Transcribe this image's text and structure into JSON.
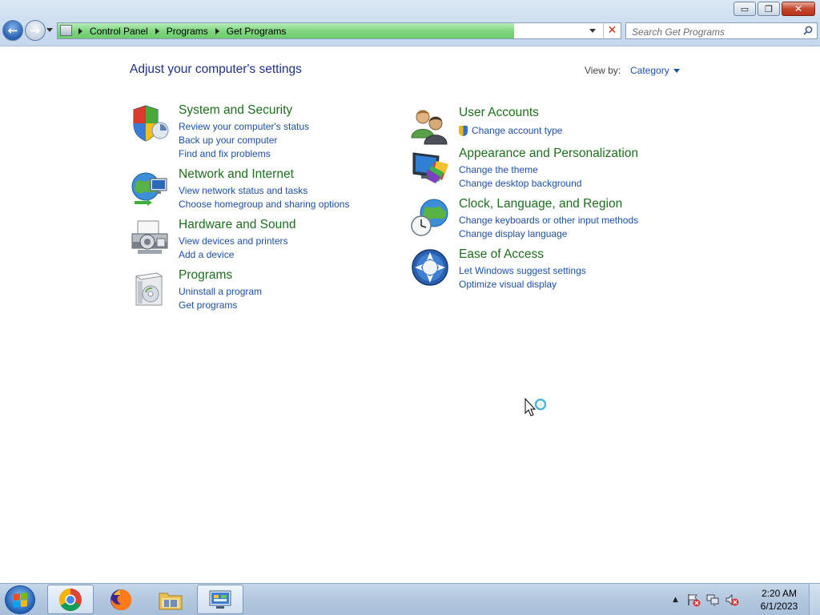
{
  "window": {
    "minimize_icon": "minimize-icon",
    "maximize_icon": "restore-icon",
    "close_icon": "close-icon",
    "minimize_glyph": "▭",
    "restore_glyph": "❐",
    "close_glyph": "✕"
  },
  "nav": {
    "back_glyph": "←",
    "forward_glyph": "→"
  },
  "address": {
    "breadcrumbs": [
      "Control Panel",
      "Programs",
      "Get Programs"
    ],
    "stop_glyph": "✕",
    "progress_color": "#7fd67f"
  },
  "search": {
    "placeholder": "Search Get Programs"
  },
  "main": {
    "heading": "Adjust your computer's settings",
    "view_by_label": "View by:",
    "view_by_value": "Category"
  },
  "categories": {
    "system_security": {
      "title": "System and Security",
      "icon": "shield-icon",
      "links": [
        "Review your computer's status",
        "Back up your computer",
        "Find and fix problems"
      ]
    },
    "network_internet": {
      "title": "Network and Internet",
      "icon": "network-globe-icon",
      "links": [
        "View network status and tasks",
        "Choose homegroup and sharing options"
      ]
    },
    "hardware_sound": {
      "title": "Hardware and Sound",
      "icon": "printer-icon",
      "links": [
        "View devices and printers",
        "Add a device"
      ]
    },
    "programs": {
      "title": "Programs",
      "icon": "programs-box-icon",
      "links": [
        "Uninstall a program",
        "Get programs"
      ]
    },
    "user_accounts": {
      "title": "User Accounts",
      "icon": "users-icon",
      "links": [
        "Change account type"
      ]
    },
    "appearance": {
      "title": "Appearance and Personalization",
      "icon": "monitor-paint-icon",
      "links": [
        "Change the theme",
        "Change desktop background"
      ]
    },
    "clock_language": {
      "title": "Clock, Language, and Region",
      "icon": "globe-clock-icon",
      "links": [
        "Change keyboards or other input methods",
        "Change display language"
      ]
    },
    "ease_access": {
      "title": "Ease of Access",
      "icon": "ease-of-access-icon",
      "links": [
        "Let Windows suggest settings",
        "Optimize visual display"
      ]
    }
  },
  "taskbar": {
    "apps": [
      {
        "name": "Google Chrome",
        "icon": "chrome-icon"
      },
      {
        "name": "Firefox",
        "icon": "firefox-icon"
      },
      {
        "name": "Windows Explorer",
        "icon": "explorer-icon"
      },
      {
        "name": "Control Panel",
        "icon": "control-panel-icon",
        "active": true
      }
    ],
    "tray_arrow_glyph": "▲",
    "clock_time": "2:20 AM",
    "clock_date": "6/1/2023"
  },
  "colors": {
    "category_title": "#1e6d1e",
    "link": "#1e50a2",
    "heading": "#1e3287"
  }
}
